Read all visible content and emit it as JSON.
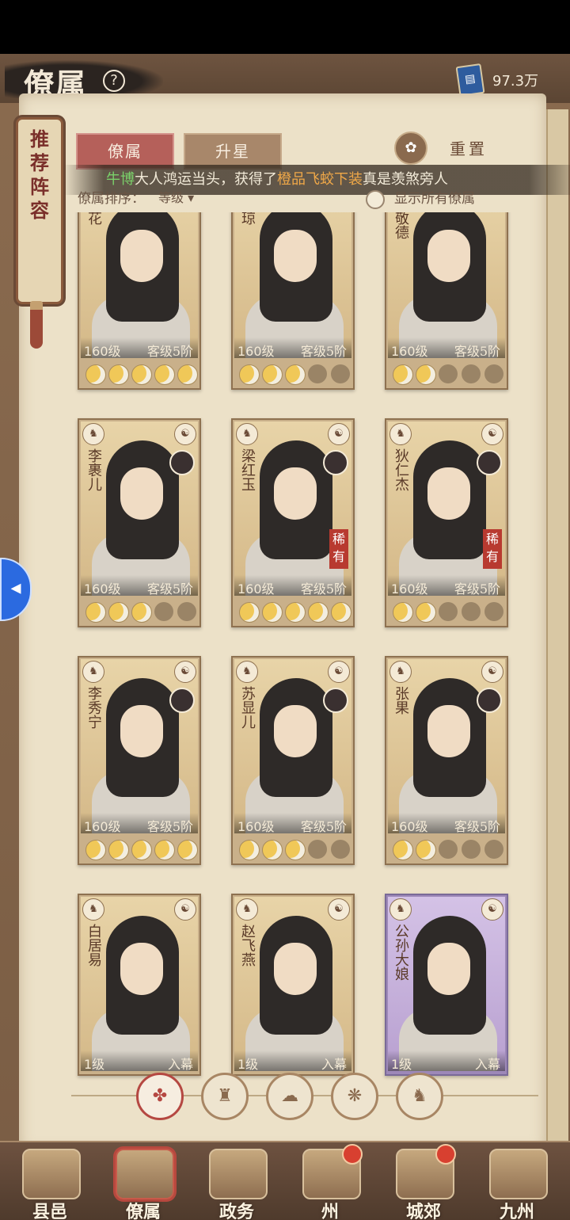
{
  "header": {
    "title": "僚属",
    "help_icon": "question-icon",
    "currency_icon": "book-icon",
    "currency_value": "97.3万"
  },
  "side_tag": {
    "text": "推荐阵容"
  },
  "tabs": [
    {
      "label": "僚属",
      "active": true
    },
    {
      "label": "升星",
      "active": false
    }
  ],
  "reset": {
    "label": "重置",
    "icon": "reset-icon"
  },
  "marquee": {
    "name": "牛博",
    "mid": "大人鸿运当头，获得了",
    "item": "橙品飞蛟下装",
    "end": "真是羡煞旁人"
  },
  "sort": {
    "label": "僚属排序：",
    "value": "等级",
    "show_all_label": "显示所有僚属"
  },
  "cards": [
    {
      "name": "花",
      "level": "160级",
      "rank": "客级5阶",
      "stars": 5,
      "rare": false,
      "purple": false
    },
    {
      "name": "琼",
      "level": "160级",
      "rank": "客级5阶",
      "stars": 3,
      "rare": false,
      "purple": false
    },
    {
      "name": "敬德",
      "level": "160级",
      "rank": "客级5阶",
      "stars": 2,
      "rare": false,
      "purple": false
    },
    {
      "name": "李裹儿",
      "level": "160级",
      "rank": "客级5阶",
      "stars": 3,
      "rare": false,
      "purple": false
    },
    {
      "name": "梁红玉",
      "level": "160级",
      "rank": "客级5阶",
      "stars": 5,
      "rare": true,
      "purple": false
    },
    {
      "name": "狄仁杰",
      "level": "160级",
      "rank": "客级5阶",
      "stars": 2,
      "rare": true,
      "purple": false
    },
    {
      "name": "李秀宁",
      "level": "160级",
      "rank": "客级5阶",
      "stars": 5,
      "rare": false,
      "purple": false
    },
    {
      "name": "苏显儿",
      "level": "160级",
      "rank": "客级5阶",
      "stars": 3,
      "rare": false,
      "purple": false
    },
    {
      "name": "张果",
      "level": "160级",
      "rank": "客级5阶",
      "stars": 2,
      "rare": false,
      "purple": false
    },
    {
      "name": "白居易",
      "level": "1级",
      "rank": "入幕",
      "stars": 0,
      "rare": false,
      "purple": false
    },
    {
      "name": "赵飞燕",
      "level": "1级",
      "rank": "入幕",
      "stars": 0,
      "rare": false,
      "purple": false
    },
    {
      "name": "公孙大娘",
      "level": "1级",
      "rank": "入幕",
      "stars": 0,
      "rare": false,
      "purple": true
    }
  ],
  "rare_label": "稀有",
  "filters": [
    {
      "icon": "all-factions-icon",
      "glyph": "✤",
      "active": true
    },
    {
      "icon": "mountain-faction-icon",
      "glyph": "♜",
      "active": false
    },
    {
      "icon": "cloud-faction-icon",
      "glyph": "☁",
      "active": false
    },
    {
      "icon": "fan-faction-icon",
      "glyph": "❋",
      "active": false
    },
    {
      "icon": "lion-faction-icon",
      "glyph": "♞",
      "active": false
    }
  ],
  "bottom_nav": [
    {
      "label": "县邑",
      "active": false,
      "dot": false
    },
    {
      "label": "僚属",
      "active": true,
      "dot": false
    },
    {
      "label": "政务",
      "active": false,
      "dot": false
    },
    {
      "label": "州",
      "active": false,
      "dot": true
    },
    {
      "label": "城郊",
      "active": false,
      "dot": true
    },
    {
      "label": "九州",
      "active": false,
      "dot": false
    }
  ]
}
